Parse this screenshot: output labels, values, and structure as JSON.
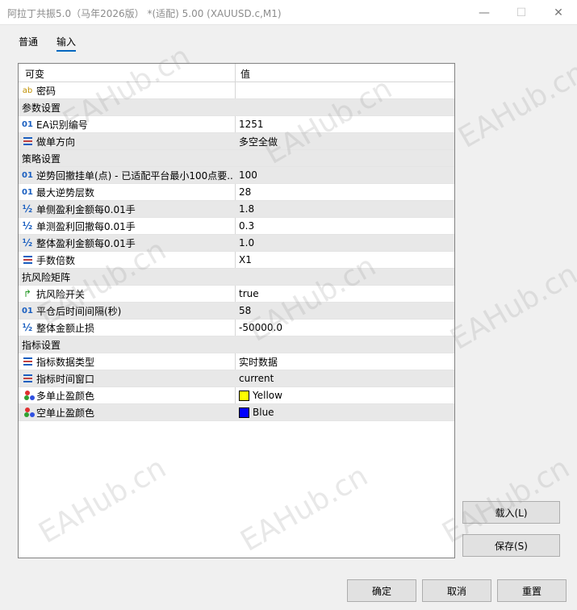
{
  "window": {
    "title": "阿拉丁共振5.0（马年2026版） *(适配) 5.00 (XAUUSD.c,M1)",
    "minimize_glyph": "—",
    "maximize_glyph": "☐",
    "close_glyph": "✕"
  },
  "tabs": {
    "general": "普通",
    "inputs": "输入"
  },
  "grid": {
    "col_variable": "可变",
    "col_value": "值",
    "rows": [
      {
        "type": "str",
        "name": "密码",
        "value": ""
      },
      {
        "type": "group",
        "name": "参数设置",
        "value": ""
      },
      {
        "type": "int",
        "name": "EA识别编号",
        "value": "1251"
      },
      {
        "type": "enum",
        "name": "做单方向",
        "value": "多空全做"
      },
      {
        "type": "group",
        "name": "策略设置",
        "value": ""
      },
      {
        "type": "int",
        "name": "逆势回撤挂单(点) - 已适配平台最小100点要...",
        "value": "100"
      },
      {
        "type": "int",
        "name": "最大逆势层数",
        "value": "28"
      },
      {
        "type": "frac",
        "name": "单侧盈利金额每0.01手",
        "value": "1.8"
      },
      {
        "type": "frac",
        "name": "单测盈利回撤每0.01手",
        "value": "0.3"
      },
      {
        "type": "frac",
        "name": "整体盈利金额每0.01手",
        "value": "1.0"
      },
      {
        "type": "enum",
        "name": "手数倍数",
        "value": "X1"
      },
      {
        "type": "group",
        "name": "抗风险矩阵",
        "value": ""
      },
      {
        "type": "bool",
        "name": "抗风险开关",
        "value": "true"
      },
      {
        "type": "int",
        "name": "平仓后时间间隔(秒)",
        "value": "58"
      },
      {
        "type": "frac",
        "name": "整体金额止损",
        "value": "-50000.0"
      },
      {
        "type": "group",
        "name": "指标设置",
        "value": ""
      },
      {
        "type": "enum",
        "name": "指标数据类型",
        "value": "实时数据"
      },
      {
        "type": "enum",
        "name": "指标时间窗口",
        "value": "current"
      },
      {
        "type": "color",
        "name": "多单止盈颜色",
        "value": "Yellow",
        "swatch": "#ffff00"
      },
      {
        "type": "color",
        "name": "空单止盈颜色",
        "value": "Blue",
        "swatch": "#0000ff"
      }
    ]
  },
  "icons": {
    "int": "01",
    "str": "ab",
    "frac": "½",
    "bool": "↱"
  },
  "buttons": {
    "load": "载入(L)",
    "save": "保存(S)",
    "ok": "确定",
    "cancel": "取消",
    "reset": "重置"
  },
  "watermark": "EAHub.cn",
  "colors": {
    "accent": "#0067c0",
    "alt_row": "#e8e8e8"
  }
}
